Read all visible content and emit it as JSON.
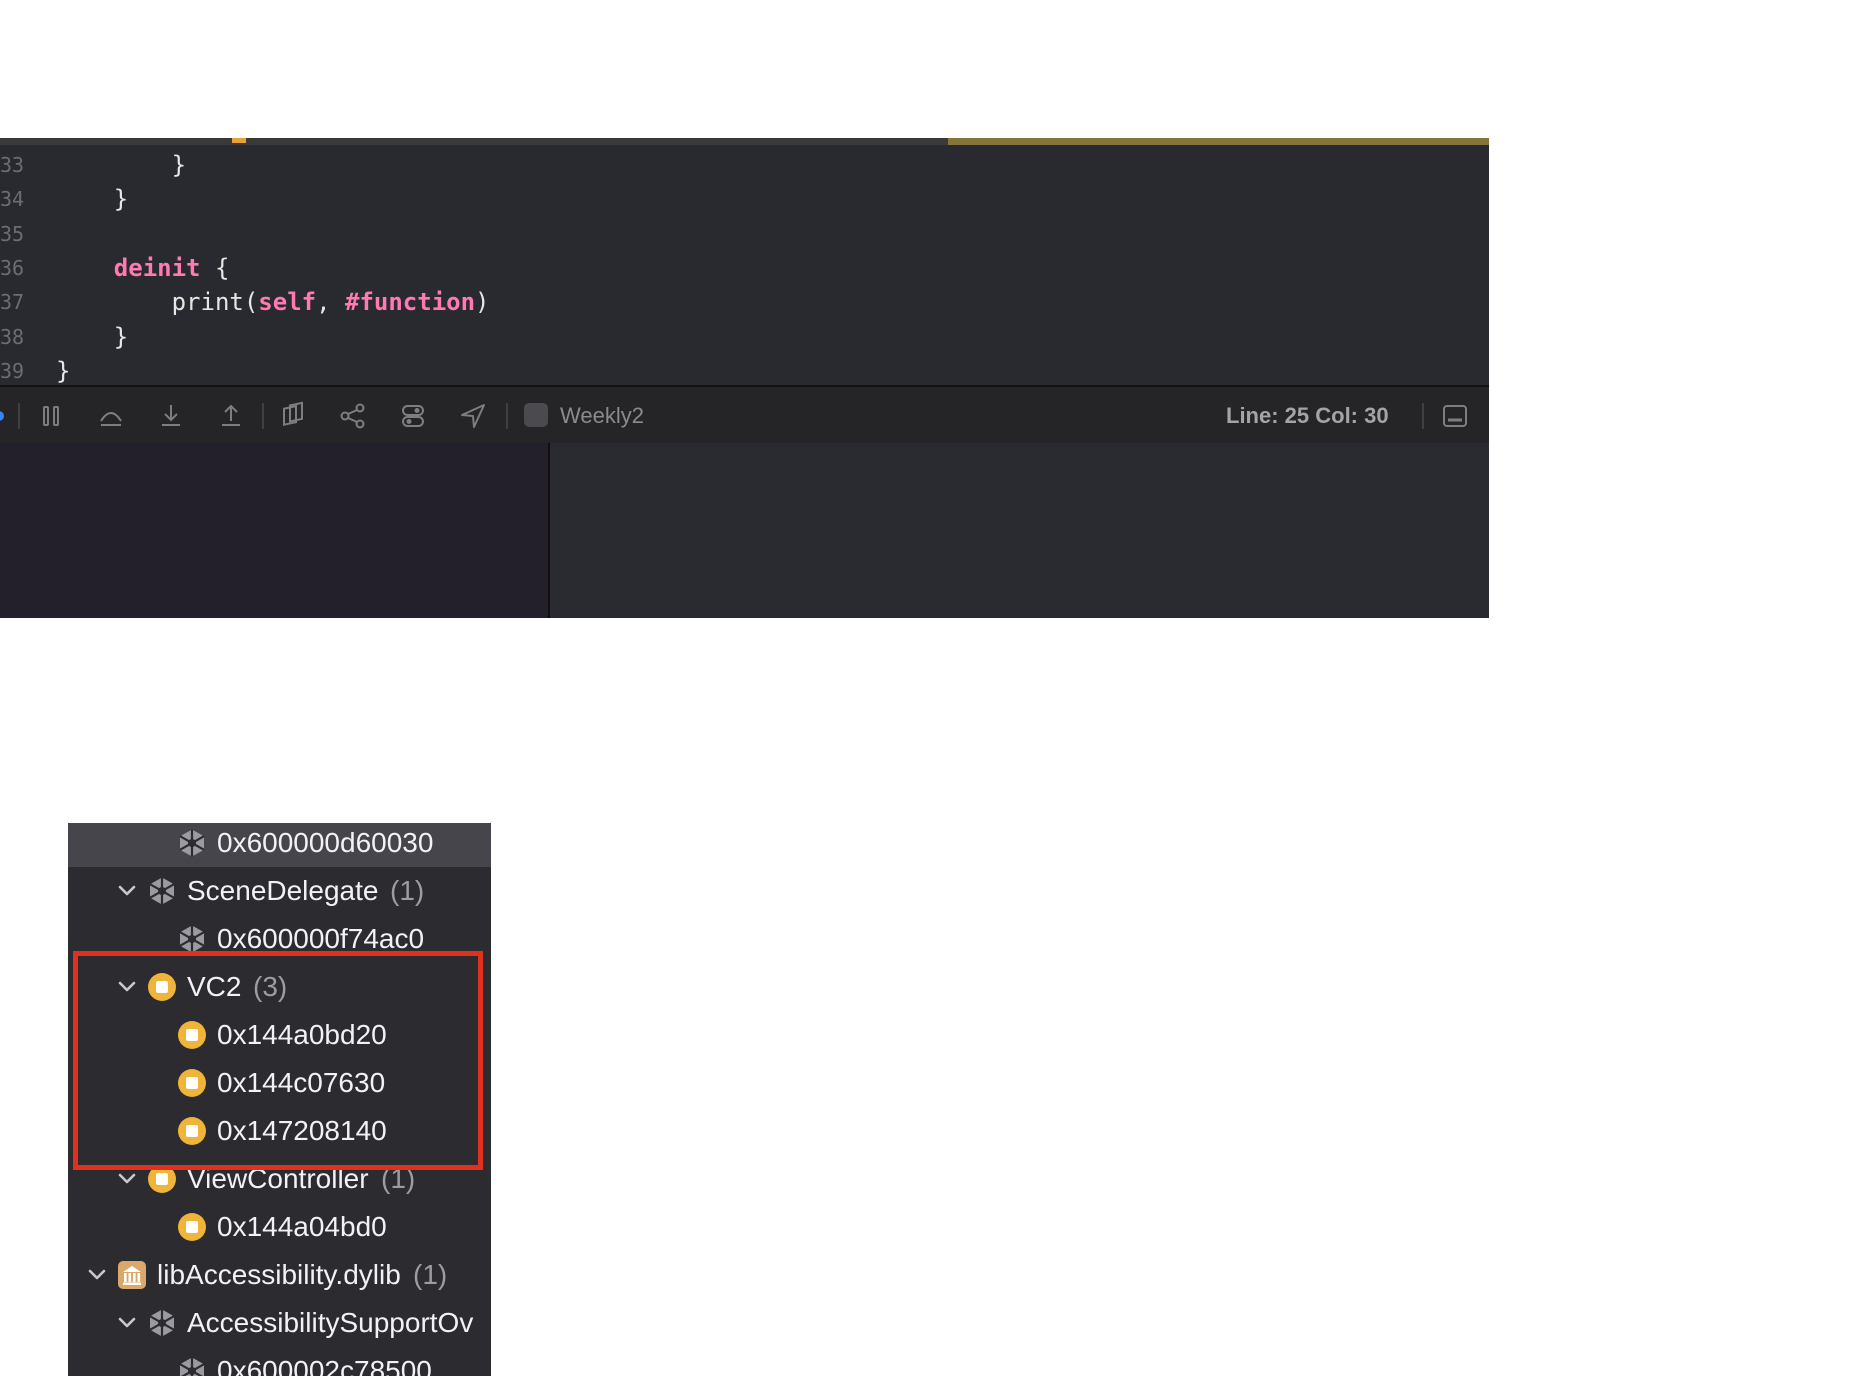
{
  "editor": {
    "lines": [
      {
        "num": "33",
        "text": "        }"
      },
      {
        "num": "34",
        "text": "    }"
      },
      {
        "num": "35",
        "text": ""
      },
      {
        "num": "36",
        "parts": [
          {
            "t": "    ",
            "k": false
          },
          {
            "t": "deinit",
            "k": true
          },
          {
            "t": " {",
            "k": false
          }
        ]
      },
      {
        "num": "37",
        "parts": [
          {
            "t": "        print(",
            "k": false
          },
          {
            "t": "self",
            "k": true
          },
          {
            "t": ", ",
            "k": false
          },
          {
            "t": "#function",
            "k": true
          },
          {
            "t": ")",
            "k": false
          }
        ]
      },
      {
        "num": "38",
        "text": "    }"
      },
      {
        "num": "39",
        "text": "}"
      }
    ]
  },
  "debug_bar": {
    "scheme": "Weekly2",
    "cursor": "Line: 25  Col: 30"
  },
  "memory_graph": {
    "rows": [
      {
        "indent": 2,
        "expanded": null,
        "icon": "struct-icon",
        "label": "0x600000d60030",
        "count": "",
        "selected": true
      },
      {
        "indent": 1,
        "expanded": true,
        "icon": "struct-icon",
        "label": "SceneDelegate",
        "count": "(1)"
      },
      {
        "indent": 2,
        "expanded": null,
        "icon": "struct-icon",
        "label": "0x600000f74ac0",
        "count": ""
      },
      {
        "indent": 1,
        "expanded": true,
        "icon": "class-icon",
        "label": "VC2",
        "count": "(3)"
      },
      {
        "indent": 2,
        "expanded": null,
        "icon": "class-icon",
        "label": "0x144a0bd20",
        "count": ""
      },
      {
        "indent": 2,
        "expanded": null,
        "icon": "class-icon",
        "label": "0x144c07630",
        "count": ""
      },
      {
        "indent": 2,
        "expanded": null,
        "icon": "class-icon",
        "label": "0x147208140",
        "count": ""
      },
      {
        "indent": 1,
        "expanded": true,
        "icon": "class-icon",
        "label": "ViewController",
        "count": "(1)"
      },
      {
        "indent": 2,
        "expanded": null,
        "icon": "class-icon",
        "label": "0x144a04bd0",
        "count": ""
      },
      {
        "indent": 0,
        "expanded": true,
        "icon": "library-icon",
        "label": "libAccessibility.dylib",
        "count": "(1)"
      },
      {
        "indent": 1,
        "expanded": true,
        "icon": "struct-icon",
        "label": "AccessibilitySupportOv",
        "count": ""
      },
      {
        "indent": 2,
        "expanded": null,
        "icon": "struct-icon",
        "label": "0x600002c78500",
        "count": ""
      }
    ]
  },
  "colors": {
    "class_icon": "#f0b43a",
    "highlight": "#e0301e",
    "keyword": "#ff7ab2"
  }
}
